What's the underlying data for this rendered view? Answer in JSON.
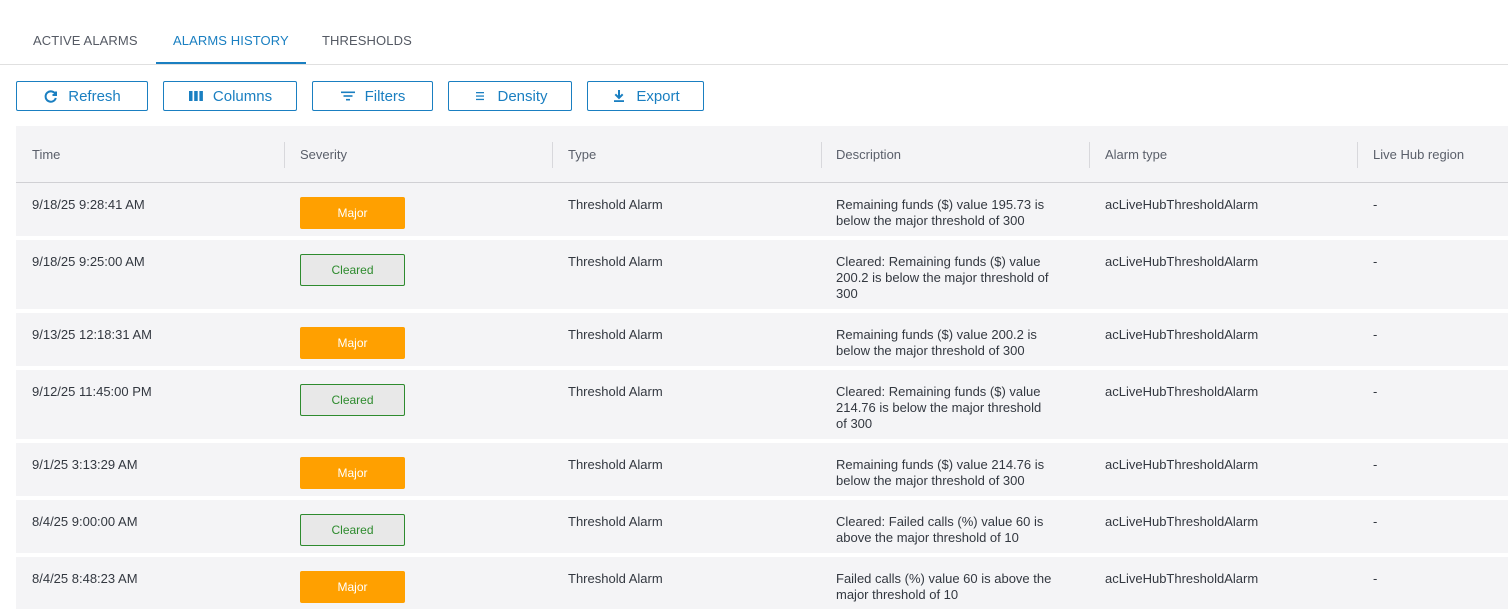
{
  "tabs": [
    {
      "label": "ACTIVE ALARMS",
      "active": false
    },
    {
      "label": "ALARMS HISTORY",
      "active": true
    },
    {
      "label": "THRESHOLDS",
      "active": false
    }
  ],
  "toolbar": {
    "refresh_label": "Refresh",
    "columns_label": "Columns",
    "filters_label": "Filters",
    "density_label": "Density",
    "export_label": "Export"
  },
  "colors": {
    "accent": "#1a7fc1",
    "major": "#ffa000",
    "cleared_text": "#2e8b2e",
    "header_bg": "#f4f4f6"
  },
  "table": {
    "columns": [
      "Time",
      "Severity",
      "Type",
      "Description",
      "Alarm type",
      "Live Hub region"
    ],
    "rows": [
      {
        "time": "9/18/25 9:28:41 AM",
        "severity": "Major",
        "type": "Threshold Alarm",
        "description": [
          "Remaining funds ($) value 195.73 is",
          "below the major threshold of 300"
        ],
        "alarm_type": "acLiveHubThresholdAlarm",
        "region": "-"
      },
      {
        "time": "9/18/25 9:25:00 AM",
        "severity": "Cleared",
        "type": "Threshold Alarm",
        "description": [
          "Cleared: Remaining funds ($) value",
          "200.2 is below the major threshold of",
          "300"
        ],
        "alarm_type": "acLiveHubThresholdAlarm",
        "region": "-"
      },
      {
        "time": "9/13/25 12:18:31 AM",
        "severity": "Major",
        "type": "Threshold Alarm",
        "description": [
          "Remaining funds ($) value 200.2 is",
          "below the major threshold of 300"
        ],
        "alarm_type": "acLiveHubThresholdAlarm",
        "region": "-"
      },
      {
        "time": "9/12/25 11:45:00 PM",
        "severity": "Cleared",
        "type": "Threshold Alarm",
        "description": [
          "Cleared: Remaining funds ($) value",
          "214.76 is below the major threshold",
          "of 300"
        ],
        "alarm_type": "acLiveHubThresholdAlarm",
        "region": "-"
      },
      {
        "time": "9/1/25 3:13:29 AM",
        "severity": "Major",
        "type": "Threshold Alarm",
        "description": [
          "Remaining funds ($) value 214.76 is",
          "below the major threshold of 300"
        ],
        "alarm_type": "acLiveHubThresholdAlarm",
        "region": "-"
      },
      {
        "time": "8/4/25 9:00:00 AM",
        "severity": "Cleared",
        "type": "Threshold Alarm",
        "description": [
          "Cleared: Failed calls (%) value 60 is",
          "above the major threshold of 10"
        ],
        "alarm_type": "acLiveHubThresholdAlarm",
        "region": "-"
      },
      {
        "time": "8/4/25 8:48:23 AM",
        "severity": "Major",
        "type": "Threshold Alarm",
        "description": [
          "Failed calls (%) value 60 is above the",
          "major threshold of 10"
        ],
        "alarm_type": "acLiveHubThresholdAlarm",
        "region": "-"
      }
    ]
  }
}
